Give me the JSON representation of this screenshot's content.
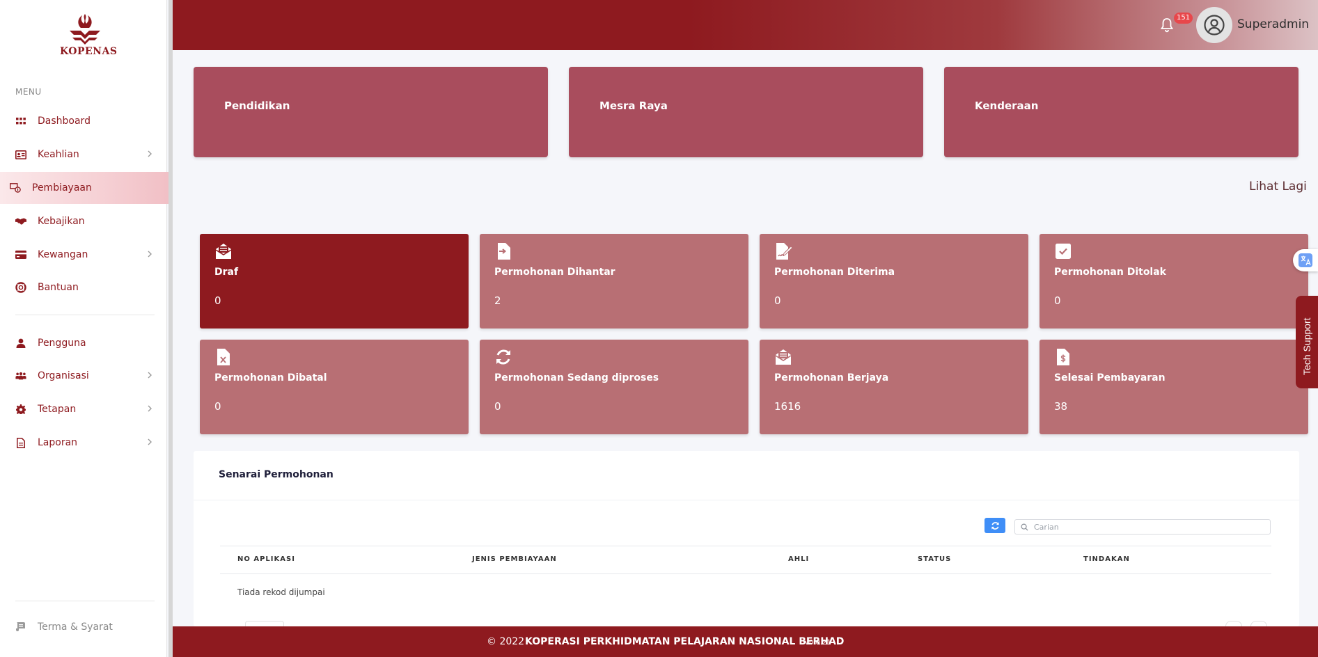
{
  "brand": {
    "logo_text": "KOPENAS"
  },
  "sidebar": {
    "caption": "MENU",
    "items": [
      {
        "label": "Dashboard",
        "icon": "grid-icon"
      },
      {
        "label": "Keahlian",
        "icon": "id-card-icon"
      },
      {
        "label": "Pembiayaan",
        "icon": "finance-icon"
      },
      {
        "label": "Kebajikan",
        "icon": "handshake-icon"
      },
      {
        "label": "Kewangan",
        "icon": "credit-card-icon"
      },
      {
        "label": "Bantuan",
        "icon": "lifebuoy-icon"
      },
      {
        "label": "Pengguna",
        "icon": "user-icon"
      },
      {
        "label": "Organisasi",
        "icon": "users-icon"
      },
      {
        "label": "Tetapan",
        "icon": "gear-icon"
      },
      {
        "label": "Laporan",
        "icon": "file-icon"
      }
    ],
    "active": "Pembiayaan",
    "terms_label": "Terma & Syarat"
  },
  "topbar": {
    "notification_count": "151",
    "username": "Superadmin"
  },
  "categories": [
    {
      "label": "Pendidikan"
    },
    {
      "label": "Mesra Raya"
    },
    {
      "label": "Kenderaan"
    }
  ],
  "see_more_label": "Lihat Lagi",
  "stats": [
    {
      "title": "Draf",
      "value": "0",
      "icon": "envelope-open-icon"
    },
    {
      "title": "Permohonan Dihantar",
      "value": "2",
      "icon": "file-import-icon"
    },
    {
      "title": "Permohonan Diterima",
      "value": "0",
      "icon": "file-signature-icon"
    },
    {
      "title": "Permohonan Ditolak",
      "value": "0",
      "icon": "check-square-icon"
    },
    {
      "title": "Permohonan Dibatal",
      "value": "0",
      "icon": "file-excel-icon"
    },
    {
      "title": "Permohonan Sedang diproses",
      "value": "0",
      "icon": "sync-icon"
    },
    {
      "title": "Permohonan Berjaya",
      "value": "1616",
      "icon": "envelope-open-text-icon"
    },
    {
      "title": "Selesai Pembayaran",
      "value": "38",
      "icon": "file-invoice-dollar-icon"
    }
  ],
  "table": {
    "title": "Senarai Permohonan",
    "search_placeholder": "Carian",
    "columns": [
      "NO APLIKASI",
      "JENIS PEMBIAYAAN",
      "AHLI",
      "STATUS",
      "TINDAKAN"
    ],
    "empty_text": "Tiada rekod dijumpai"
  },
  "footer": {
    "copyright": "© 2022",
    "org": "KOPERASI PERKHIDMATAN PELAJARAN NASIONAL BERHAD",
    "version": "v0.0.21"
  },
  "tech_support_label": "Tech Support",
  "colors": {
    "brand": "#8e1a1f",
    "category_card": "#a94d5d",
    "stat_card": "#b86f74",
    "accent_blue": "#3f8ef7"
  }
}
